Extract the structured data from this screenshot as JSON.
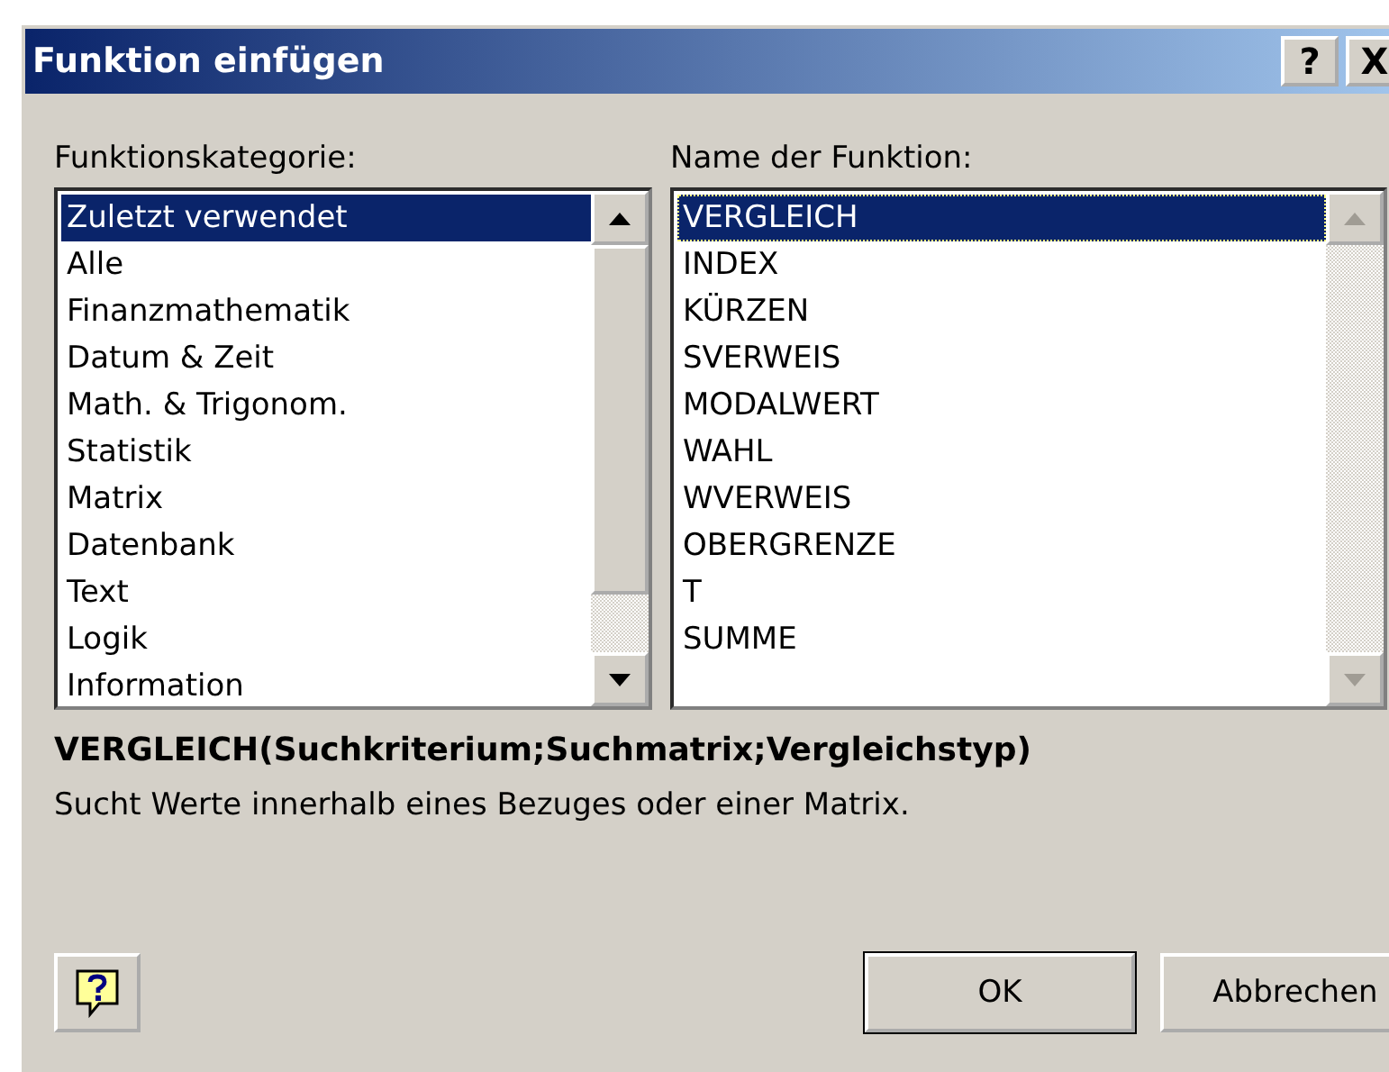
{
  "window": {
    "title": "Funktion einfügen",
    "title_buttons": [
      "?",
      "X"
    ]
  },
  "category_list": {
    "label": "Funktionskategorie:",
    "scrollbar_disabled": false,
    "items": [
      {
        "label": "Zuletzt verwendet",
        "selected": true
      },
      {
        "label": "Alle",
        "selected": false
      },
      {
        "label": "Finanzmathematik",
        "selected": false
      },
      {
        "label": "Datum & Zeit",
        "selected": false
      },
      {
        "label": "Math. & Trigonom.",
        "selected": false
      },
      {
        "label": "Statistik",
        "selected": false
      },
      {
        "label": "Matrix",
        "selected": false
      },
      {
        "label": "Datenbank",
        "selected": false
      },
      {
        "label": "Text",
        "selected": false
      },
      {
        "label": "Logik",
        "selected": false
      },
      {
        "label": "Information",
        "selected": false
      }
    ]
  },
  "function_list": {
    "label": "Name der Funktion:",
    "scrollbar_disabled": true,
    "items": [
      {
        "label": "VERGLEICH",
        "selected": true
      },
      {
        "label": "INDEX",
        "selected": false
      },
      {
        "label": "KÜRZEN",
        "selected": false
      },
      {
        "label": "SVERWEIS",
        "selected": false
      },
      {
        "label": "MODALWERT",
        "selected": false
      },
      {
        "label": "WAHL",
        "selected": false
      },
      {
        "label": "WVERWEIS",
        "selected": false
      },
      {
        "label": "OBERGRENZE",
        "selected": false
      },
      {
        "label": "T",
        "selected": false
      },
      {
        "label": "SUMME",
        "selected": false
      }
    ]
  },
  "syntax": "VERGLEICH(Suchkriterium;Suchmatrix;Vergleichstyp)",
  "description": "Sucht Werte innerhalb eines Bezuges oder einer Matrix.",
  "buttons": [
    {
      "kind": "default",
      "label": "OK"
    },
    {
      "kind": "normal",
      "label": "Abbrechen"
    }
  ]
}
